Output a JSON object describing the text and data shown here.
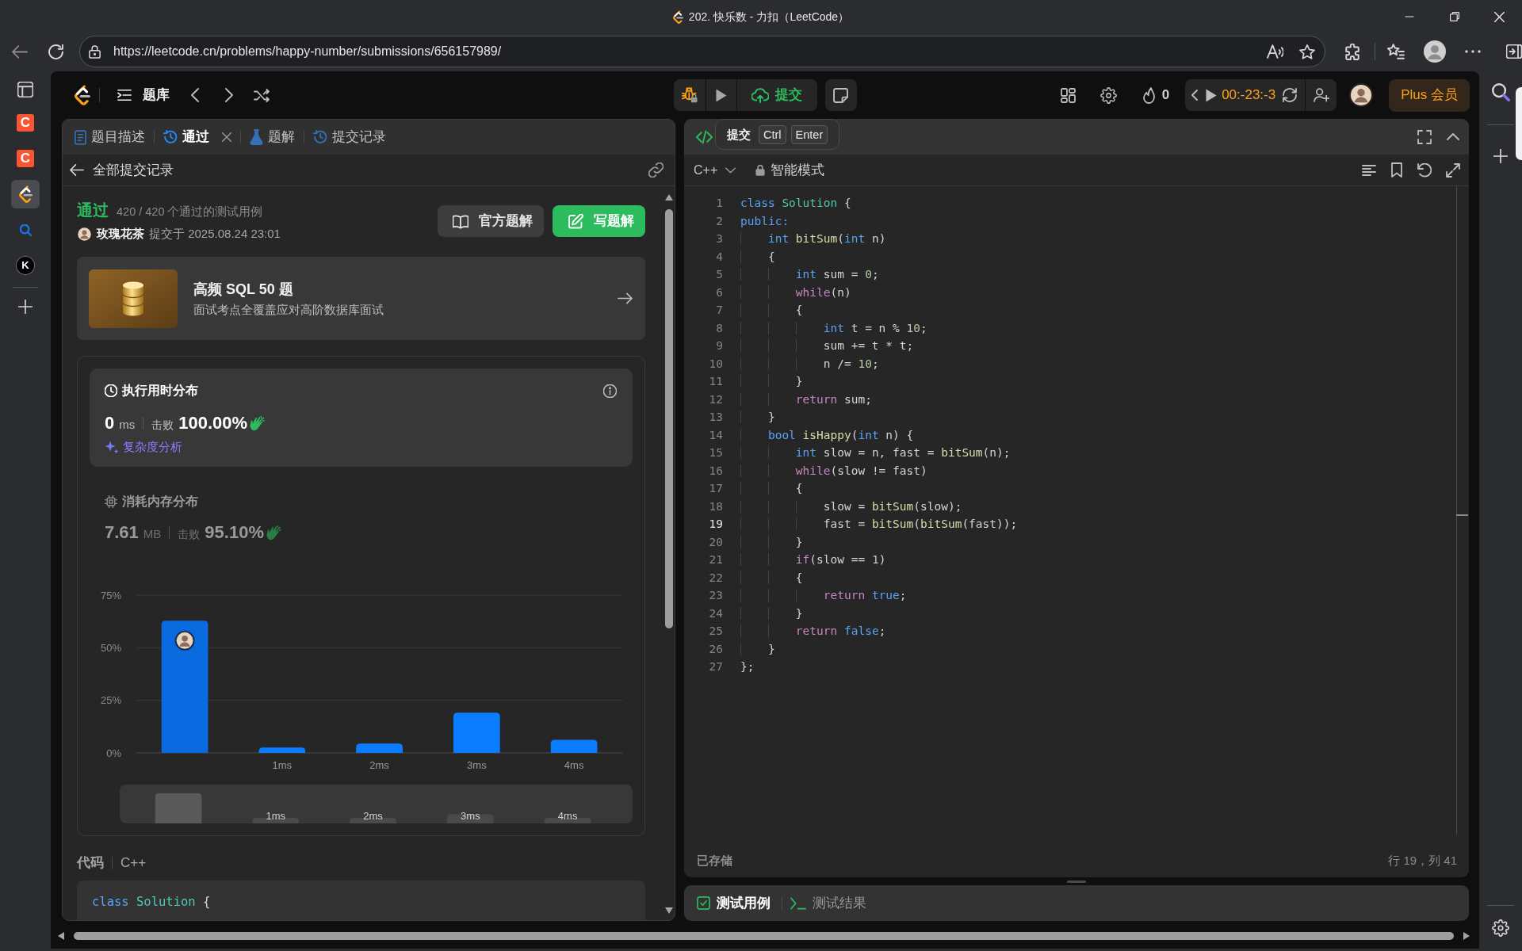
{
  "window": {
    "title": "202. 快乐数 - 力扣（LeetCode）"
  },
  "address_bar": {
    "url": "https://leetcode.cn/problems/happy-number/submissions/656157989/"
  },
  "browser_sidebar": {
    "items": [
      {
        "kind": "tile",
        "text": "C",
        "selected": false
      },
      {
        "kind": "tile",
        "text": "C",
        "selected": false
      },
      {
        "kind": "logo",
        "selected": true
      },
      {
        "kind": "search",
        "selected": false
      },
      {
        "kind": "round",
        "text": "K",
        "selected": false
      }
    ]
  },
  "header": {
    "nav_label": "题库",
    "submit_label": "提交",
    "streak": "0",
    "timer": "00:-23:-3",
    "plus_label": "Plus 会员"
  },
  "tooltip": {
    "label": "提交",
    "keys": [
      "Ctrl",
      "Enter"
    ]
  },
  "left_panel": {
    "tabs": [
      {
        "kind": "description",
        "label": "题目描述",
        "selected": false,
        "closable": false
      },
      {
        "kind": "history",
        "label": "通过",
        "selected": true,
        "closable": true
      },
      {
        "kind": "solutions",
        "label": "题解",
        "selected": false,
        "closable": false
      },
      {
        "kind": "history",
        "label": "提交记录",
        "selected": false,
        "closable": false
      }
    ],
    "back_label": "全部提交记录",
    "result": {
      "status": "通过",
      "tests": "420 / 420 个通过的测试用例",
      "user": "玫瑰花茶",
      "submitted": "提交于 2025.08.24 23:01"
    },
    "buttons": [
      {
        "kind": "secondary",
        "label": "官方题解"
      },
      {
        "kind": "primary",
        "label": "写题解"
      }
    ],
    "promo": {
      "title": "高频 SQL 50 题",
      "subtitle": "面试考点全覆盖应对高阶数据库面试"
    },
    "stats": [
      {
        "kind": "runtime",
        "selected": true,
        "title": "执行用时分布",
        "value": "0",
        "unit": "ms",
        "beat_label": "击败",
        "beat": "100.00%",
        "link": "复杂度分析"
      },
      {
        "kind": "memory",
        "selected": false,
        "title": "消耗内存分布",
        "value": "7.61",
        "unit": "MB",
        "beat_label": "击败",
        "beat": "95.10%"
      }
    ],
    "chart_data": {
      "type": "bar",
      "categories": [
        null,
        "1ms",
        "2ms",
        "3ms",
        "4ms"
      ],
      "values": [
        62.8,
        2.5,
        4.4,
        19.1,
        6.2
      ],
      "ylim": [
        0,
        75
      ],
      "yticks": [
        {
          "value": 0,
          "label": "0%"
        },
        {
          "value": 25,
          "label": "25%"
        },
        {
          "value": 50,
          "label": "50%"
        },
        {
          "value": 75,
          "label": "75%"
        }
      ]
    },
    "overview": {
      "labels": [
        "1ms",
        "2ms",
        "3ms",
        "4ms"
      ]
    },
    "code": {
      "label": "代码",
      "language": "C++",
      "lines": [
        {
          "tokens": [
            {
              "kind": "keyword",
              "text": "class"
            },
            {
              "kind": "type",
              "text": " Solution"
            },
            {
              "kind": "plain",
              "text": " {"
            }
          ]
        }
      ]
    }
  },
  "editor": {
    "language": "C++",
    "mode": "智能模式",
    "lines": [
      {
        "number": "1",
        "active": false,
        "tokens": [
          {
            "kind": "keyword",
            "text": "class"
          },
          {
            "kind": "type",
            "text": " Solution"
          },
          {
            "kind": "plain",
            "text": " {"
          }
        ]
      },
      {
        "number": "2",
        "active": false,
        "tokens": [
          {
            "kind": "keyword",
            "text": "public:"
          }
        ]
      },
      {
        "number": "3",
        "active": false,
        "tokens": [
          {
            "kind": "keyword",
            "text": "    int"
          },
          {
            "kind": "function",
            "text": " bitSum"
          },
          {
            "kind": "plain",
            "text": "("
          },
          {
            "kind": "keyword",
            "text": "int"
          },
          {
            "kind": "plain",
            "text": " n)"
          }
        ]
      },
      {
        "number": "4",
        "active": false,
        "tokens": [
          {
            "kind": "plain",
            "text": "    {"
          }
        ]
      },
      {
        "number": "5",
        "active": false,
        "tokens": [
          {
            "kind": "keyword",
            "text": "        int"
          },
          {
            "kind": "plain",
            "text": " sum = "
          },
          {
            "kind": "number",
            "text": "0"
          },
          {
            "kind": "plain",
            "text": ";"
          }
        ]
      },
      {
        "number": "6",
        "active": false,
        "tokens": [
          {
            "kind": "control",
            "text": "        while"
          },
          {
            "kind": "plain",
            "text": "(n)"
          }
        ]
      },
      {
        "number": "7",
        "active": false,
        "tokens": [
          {
            "kind": "plain",
            "text": "        {"
          }
        ]
      },
      {
        "number": "8",
        "active": false,
        "tokens": [
          {
            "kind": "keyword",
            "text": "            int"
          },
          {
            "kind": "plain",
            "text": " t = n % "
          },
          {
            "kind": "number",
            "text": "10"
          },
          {
            "kind": "plain",
            "text": ";"
          }
        ]
      },
      {
        "number": "9",
        "active": false,
        "tokens": [
          {
            "kind": "plain",
            "text": "            sum += t * t;"
          }
        ]
      },
      {
        "number": "10",
        "active": false,
        "tokens": [
          {
            "kind": "plain",
            "text": "            n /= "
          },
          {
            "kind": "number",
            "text": "10"
          },
          {
            "kind": "plain",
            "text": ";"
          }
        ]
      },
      {
        "number": "11",
        "active": false,
        "tokens": [
          {
            "kind": "plain",
            "text": "        }"
          }
        ]
      },
      {
        "number": "12",
        "active": false,
        "tokens": [
          {
            "kind": "control",
            "text": "        return"
          },
          {
            "kind": "plain",
            "text": " sum;"
          }
        ]
      },
      {
        "number": "13",
        "active": false,
        "tokens": [
          {
            "kind": "plain",
            "text": "    }"
          }
        ]
      },
      {
        "number": "14",
        "active": false,
        "tokens": [
          {
            "kind": "keyword",
            "text": "    bool"
          },
          {
            "kind": "function",
            "text": " isHappy"
          },
          {
            "kind": "plain",
            "text": "("
          },
          {
            "kind": "keyword",
            "text": "int"
          },
          {
            "kind": "plain",
            "text": " n) {"
          }
        ]
      },
      {
        "number": "15",
        "active": false,
        "tokens": [
          {
            "kind": "keyword",
            "text": "        int"
          },
          {
            "kind": "plain",
            "text": " slow = n, fast = "
          },
          {
            "kind": "function",
            "text": "bitSum"
          },
          {
            "kind": "plain",
            "text": "(n);"
          }
        ]
      },
      {
        "number": "16",
        "active": false,
        "tokens": [
          {
            "kind": "control",
            "text": "        while"
          },
          {
            "kind": "plain",
            "text": "(slow != fast)"
          }
        ]
      },
      {
        "number": "17",
        "active": false,
        "tokens": [
          {
            "kind": "plain",
            "text": "        {"
          }
        ]
      },
      {
        "number": "18",
        "active": false,
        "tokens": [
          {
            "kind": "plain",
            "text": "            slow = "
          },
          {
            "kind": "function",
            "text": "bitSum"
          },
          {
            "kind": "plain",
            "text": "(slow);"
          }
        ]
      },
      {
        "number": "19",
        "active": true,
        "tokens": [
          {
            "kind": "plain",
            "text": "            fast = "
          },
          {
            "kind": "function",
            "text": "bitSum"
          },
          {
            "kind": "plain",
            "text": "("
          },
          {
            "kind": "function",
            "text": "bitSum"
          },
          {
            "kind": "plain",
            "text": "(fast));"
          }
        ]
      },
      {
        "number": "20",
        "active": false,
        "tokens": [
          {
            "kind": "plain",
            "text": "        }"
          }
        ]
      },
      {
        "number": "21",
        "active": false,
        "tokens": [
          {
            "kind": "control",
            "text": "        if"
          },
          {
            "kind": "plain",
            "text": "(slow == "
          },
          {
            "kind": "number",
            "text": "1"
          },
          {
            "kind": "plain",
            "text": ")"
          }
        ]
      },
      {
        "number": "22",
        "active": false,
        "tokens": [
          {
            "kind": "plain",
            "text": "        {"
          }
        ]
      },
      {
        "number": "23",
        "active": false,
        "tokens": [
          {
            "kind": "control",
            "text": "            return"
          },
          {
            "kind": "keyword",
            "text": " true"
          },
          {
            "kind": "plain",
            "text": ";"
          }
        ]
      },
      {
        "number": "24",
        "active": false,
        "tokens": [
          {
            "kind": "plain",
            "text": "        }"
          }
        ]
      },
      {
        "number": "25",
        "active": false,
        "tokens": [
          {
            "kind": "control",
            "text": "        return"
          },
          {
            "kind": "keyword",
            "text": " false"
          },
          {
            "kind": "plain",
            "text": ";"
          }
        ]
      },
      {
        "number": "26",
        "active": false,
        "tokens": [
          {
            "kind": "plain",
            "text": "    }"
          }
        ]
      },
      {
        "number": "27",
        "active": false,
        "tokens": [
          {
            "kind": "plain",
            "text": "};"
          }
        ]
      }
    ],
    "status": "已存储",
    "position": "行 19，列 41"
  },
  "console": {
    "tabs": [
      {
        "kind": "testcase",
        "label": "测试用例",
        "selected": true
      },
      {
        "kind": "result",
        "label": "测试结果",
        "selected": false
      }
    ]
  }
}
